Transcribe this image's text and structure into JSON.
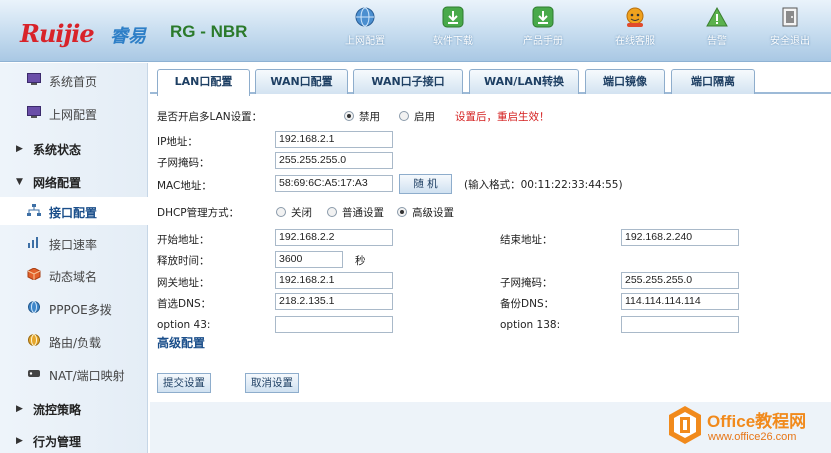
{
  "header": {
    "brand": "Ruijie",
    "brand_cn": "睿易",
    "model": "RG - NBR",
    "nav": [
      {
        "label": "上网配置",
        "icon": "globe-icon"
      },
      {
        "label": "软件下载",
        "icon": "download-icon"
      },
      {
        "label": "产品手册",
        "icon": "manual-download-icon"
      },
      {
        "label": "在线客服",
        "icon": "support-icon"
      },
      {
        "label": "告警",
        "icon": "warning-icon"
      },
      {
        "label": "安全退出",
        "icon": "logout-icon"
      }
    ]
  },
  "sidebar": {
    "items": [
      {
        "label": "系统首页",
        "icon": "monitor-icon"
      },
      {
        "label": "上网配置",
        "icon": "monitor-icon"
      }
    ],
    "groups": [
      {
        "label": "系统状态",
        "expanded": false
      },
      {
        "label": "网络配置",
        "expanded": true
      },
      {
        "label": "流控策略",
        "expanded": false
      },
      {
        "label": "行为管理",
        "expanded": false
      }
    ],
    "sub_items": [
      {
        "label": "接口配置",
        "icon": "network-icon",
        "active": true
      },
      {
        "label": "接口速率",
        "icon": "bar-chart-icon"
      },
      {
        "label": "动态域名",
        "icon": "cube-icon"
      },
      {
        "label": "PPPOE多拨",
        "icon": "globe-icon"
      },
      {
        "label": "路由/负载",
        "icon": "globe-icon"
      },
      {
        "label": "NAT/端口映射",
        "icon": "nat-icon"
      }
    ]
  },
  "tabs": [
    "LAN口配置",
    "WAN口配置",
    "WAN口子接口",
    "WAN/LAN转换",
    "端口镜像",
    "端口隔离"
  ],
  "form": {
    "multi_lan_label": "是否开启多LAN设置：",
    "opt_disable": "禁用",
    "opt_enable": "启用",
    "restart_hint": "设置后，重启生效！",
    "ip_label": "IP地址：",
    "ip_value": "192.168.2.1",
    "mask_label": "子网掩码：",
    "mask_value": "255.255.255.0",
    "mac_label": "MAC地址：",
    "mac_value": "58:69:6C:A5:17:A3",
    "random_button": "随 机",
    "mac_format_hint": "(输入格式：00:11:22:33:44:55)",
    "dhcp_label": "DHCP管理方式：",
    "dhcp_off": "关闭",
    "dhcp_normal": "普通设置",
    "dhcp_advanced": "高级设置",
    "start_label": "开始地址：",
    "start_value": "192.168.2.2",
    "end_label": "结束地址：",
    "end_value": "192.168.2.240",
    "lease_label": "释放时间：",
    "lease_value": "3600",
    "lease_unit": "秒",
    "gateway_label": "网关地址：",
    "gateway_value": "192.168.2.1",
    "submask_label": "子网掩码：",
    "submask_value": "255.255.255.0",
    "dns1_label": "首选DNS：",
    "dns1_value": "218.2.135.1",
    "dns2_label": "备份DNS：",
    "dns2_value": "114.114.114.114",
    "opt43_label": "option 43:",
    "opt43_value": "",
    "opt138_label": "option 138:",
    "opt138_value": "",
    "advanced_label": "高级配置",
    "submit_button": "提交设置",
    "cancel_button": "取消设置"
  },
  "watermark": {
    "title": "Office教程网",
    "url": "www.office26.com"
  },
  "colors": {
    "accent": "#1a4e8a",
    "warning": "#d41f1f",
    "brand_red": "#d8232a",
    "watermark_orange": "#f18a1c"
  }
}
